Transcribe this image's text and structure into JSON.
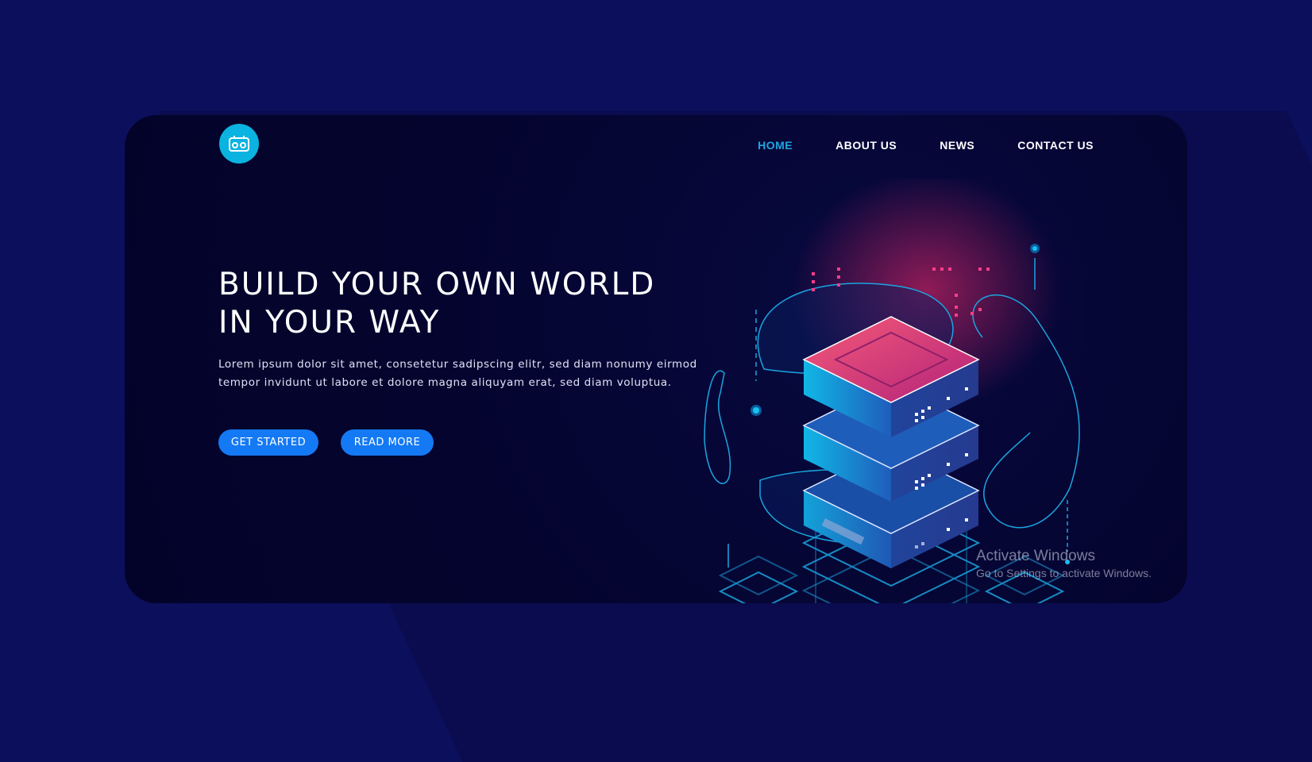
{
  "nav": {
    "items": [
      {
        "label": "HOME",
        "active": true
      },
      {
        "label": "ABOUT US",
        "active": false
      },
      {
        "label": "NEWS",
        "active": false
      },
      {
        "label": "CONTACT US",
        "active": false
      }
    ]
  },
  "hero": {
    "title_line1": "BUILD YOUR OWN WORLD",
    "title_line2": "IN YOUR WAY",
    "text": "Lorem ipsum dolor sit amet, consetetur sadipscing elitr, sed diam nonumy eirmod tempor invidunt ut labore et dolore magna aliquyam erat, sed diam voluptua.",
    "primary_button": "GET STARTED",
    "secondary_button": "READ MORE"
  },
  "watermark": {
    "title": "Activate Windows",
    "subtitle": "Go to Settings to activate Windows."
  },
  "icons": {
    "logo": "robot-face-icon"
  },
  "colors": {
    "background": "#0c0f5c",
    "card": "#04042e",
    "accent": "#0bb3e0",
    "button": "#1479f4",
    "nav_active": "#1fa6e0"
  }
}
